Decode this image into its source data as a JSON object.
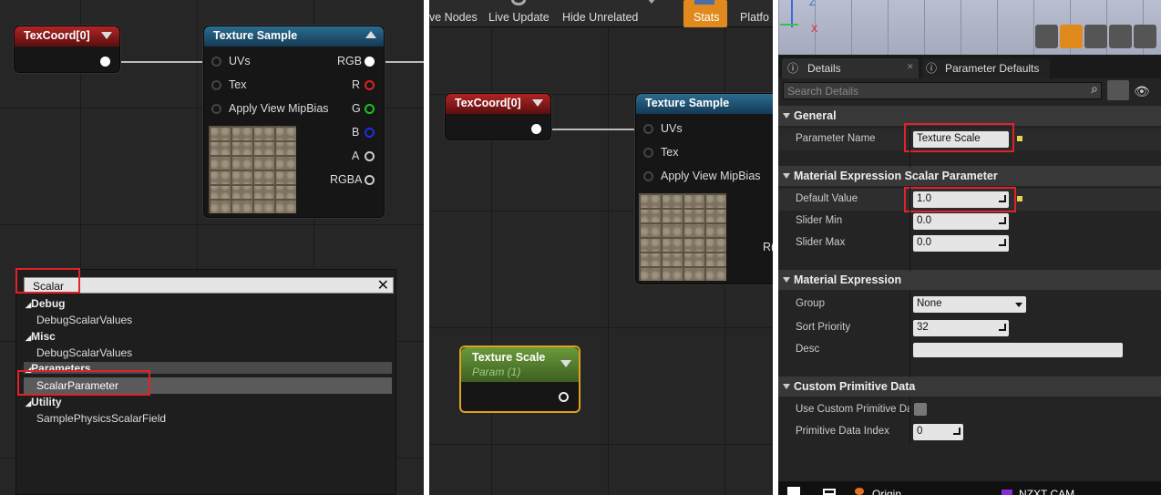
{
  "left_graph": {
    "texcoord_node": {
      "title": "TexCoord[0]"
    },
    "texture_sample": {
      "title": "Texture Sample",
      "inputs": [
        "UVs",
        "Tex",
        "Apply View MipBias"
      ],
      "outputs": [
        "RGB",
        "R",
        "G",
        "B",
        "A",
        "RGBA"
      ],
      "output_colors": [
        "#ffffff",
        "#e02020",
        "#20c020",
        "#2030e0",
        "#cccccc",
        "#cccccc"
      ]
    },
    "search_menu": {
      "query": "Scalar",
      "categories": [
        {
          "name": "Debug",
          "items": [
            "DebugScalarValues"
          ]
        },
        {
          "name": "Misc",
          "items": [
            "DebugScalarValues"
          ]
        },
        {
          "name": "Parameters",
          "items": [
            "ScalarParameter"
          ]
        },
        {
          "name": "Utility",
          "items": [
            "SamplePhysicsScalarField"
          ]
        }
      ]
    }
  },
  "middle_graph": {
    "toolbar": {
      "items": [
        "ve Nodes",
        "Live Update",
        "Hide Unrelated",
        "Stats",
        "Platfo"
      ]
    },
    "texcoord_node": {
      "title": "TexCoord[0]"
    },
    "texture_sample": {
      "title": "Texture Sample",
      "inputs": [
        "UVs",
        "Tex",
        "Apply View MipBias"
      ],
      "partial_output": "R("
    },
    "param_node": {
      "title": "Texture Scale",
      "subtitle": "Param (1)"
    }
  },
  "details": {
    "tabs": [
      "Details",
      "Parameter Defaults"
    ],
    "search_placeholder": "Search Details",
    "sections": {
      "general": "General",
      "scalar_param": "Material Expression Scalar Parameter",
      "material_expr": "Material Expression",
      "custom_prim": "Custom Primitive Data"
    },
    "parameter_name_label": "Parameter Name",
    "parameter_name_value": "Texture Scale",
    "default_value_label": "Default Value",
    "default_value": "1.0",
    "slider_min_label": "Slider Min",
    "slider_min": "0.0",
    "slider_max_label": "Slider Max",
    "slider_max": "0.0",
    "group_label": "Group",
    "group_value": "None",
    "sort_priority_label": "Sort Priority",
    "sort_priority": "32",
    "desc_label": "Desc",
    "desc_value": "",
    "use_custom_label": "Use Custom Primitive Da",
    "primitive_index_label": "Primitive Data Index",
    "primitive_index": "0",
    "taskbar": {
      "items": [
        "Origin",
        "NZXT CAM"
      ]
    }
  },
  "colors": {
    "highlight": "#e0222a",
    "stats_button": "#e08a1e",
    "node_selected_border": "#e0a020"
  }
}
